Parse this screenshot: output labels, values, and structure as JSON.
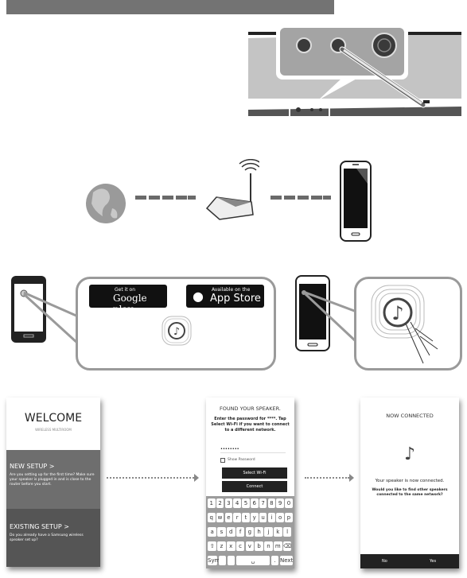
{
  "badges": {
    "google": {
      "small": "Get it on",
      "big": "Google play"
    },
    "apple": {
      "small": "Available on the",
      "big": "App Store"
    }
  },
  "welcome": {
    "title": "WELCOME",
    "subtitle": "WIRELESS MULTIROOM",
    "new_setup": {
      "label": "NEW SETUP >",
      "desc": "Are you setting up for the first time? Make sure your speaker is plugged in and is close to the router before you start."
    },
    "existing_setup": {
      "label": "EXISTING SETUP >",
      "desc": "Do you already have a Samsung wireless speaker set up?"
    }
  },
  "found": {
    "title": "FOUND YOUR SPEAKER.",
    "message": "Enter the password for ****. Tap Select Wi-Fi if you want to connect to a different network.",
    "password_value": "••••••••",
    "show_password": "Show Password",
    "select_wifi": "Select Wi-Fi",
    "connect": "Connect",
    "keyboard": {
      "rows": [
        [
          "1",
          "2",
          "3",
          "4",
          "5",
          "6",
          "7",
          "8",
          "9",
          "0"
        ],
        [
          "q",
          "w",
          "e",
          "r",
          "t",
          "y",
          "u",
          "i",
          "o",
          "p"
        ],
        [
          "a",
          "s",
          "d",
          "f",
          "g",
          "h",
          "j",
          "k",
          "l"
        ],
        [
          "⇧",
          "z",
          "x",
          "c",
          "v",
          "b",
          "n",
          "m",
          "⌫"
        ]
      ],
      "sym": "Sym",
      "space": "␣",
      "period": ".",
      "next": "Next"
    }
  },
  "connected": {
    "title": "NOW CONNECTED",
    "message": "Your speaker is now connected.",
    "question": "Would you like to find other speakers connected to the same network?",
    "no": "No",
    "yes": "Yes"
  },
  "colors": {
    "banner": "#737373",
    "dark_button": "#222222"
  }
}
